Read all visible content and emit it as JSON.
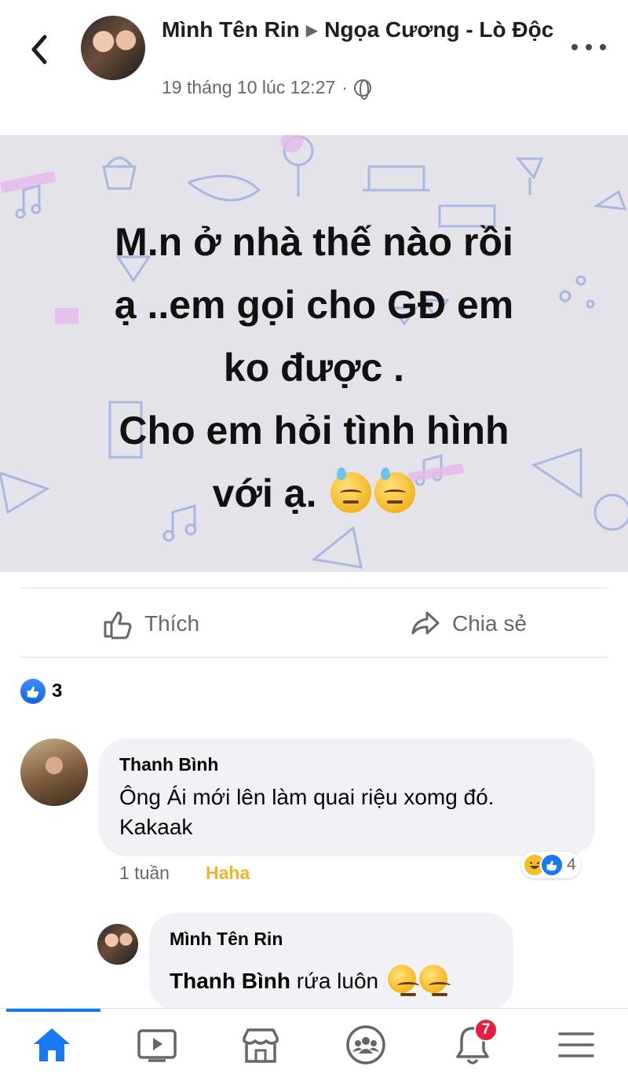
{
  "header": {
    "author": "Mình Tên Rin",
    "target": "Ngọa Cương - Lò Độc",
    "timestamp": "19 tháng 10 lúc 12:27",
    "separator": "·",
    "privacy_icon": "globe-icon"
  },
  "post": {
    "line1": "M.n ở nhà thế nào rồi",
    "line2": "ạ ..em gọi cho GĐ em",
    "line3": "ko được .",
    "line4": "Cho em hỏi tình hình",
    "line5": "với ạ.",
    "background_color": "#e4e3e9"
  },
  "actions": {
    "like_label": "Thích",
    "share_label": "Chia sẻ"
  },
  "reactions": {
    "count": "3"
  },
  "comments": [
    {
      "name": "Thanh Bình",
      "text_line1": "Ông Ái mới lên làm quai riệu xomg đó.",
      "text_line2": "Kakaak",
      "time": "1 tuần",
      "reaction_label": "Haha",
      "reaction_count": "4"
    },
    {
      "name": "Mình Tên Rin",
      "mention": "Thanh Bình",
      "text": "rứa luôn"
    }
  ],
  "nav": {
    "notification_badge": "7",
    "accent": "#1877f2"
  }
}
